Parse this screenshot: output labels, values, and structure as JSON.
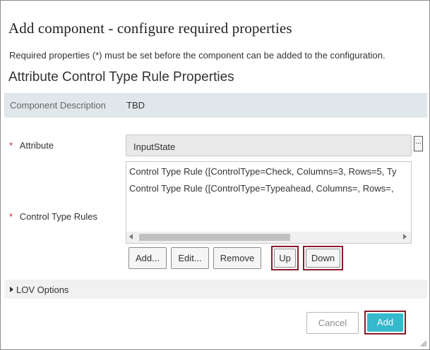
{
  "dialog": {
    "title": "Add component - configure required properties",
    "note": "Required properties (*) must be set before the component can be added to the configuration.",
    "section_title": "Attribute Control Type Rule Properties"
  },
  "description": {
    "label": "Component Description",
    "value": "TBD"
  },
  "attribute": {
    "required_marker": "*",
    "label": "Attribute",
    "value": "InputState",
    "browse_label": "..."
  },
  "rules": {
    "required_marker": "*",
    "label": "Control Type Rules",
    "items": [
      "Control Type Rule ([ControlType=Check, Columns=3, Rows=5, Ty",
      "Control Type Rule ([ControlType=Typeahead, Columns=, Rows=,"
    ],
    "buttons": {
      "add": "Add...",
      "edit": "Edit...",
      "remove": "Remove",
      "up": "Up",
      "down": "Down"
    }
  },
  "lov": {
    "label": "LOV Options"
  },
  "footer": {
    "cancel": "Cancel",
    "add": "Add"
  },
  "colors": {
    "accent": "#35b9cc",
    "highlight": "#8b1a2b",
    "required": "#c4262e",
    "description_bar": "#dfe7ea"
  }
}
